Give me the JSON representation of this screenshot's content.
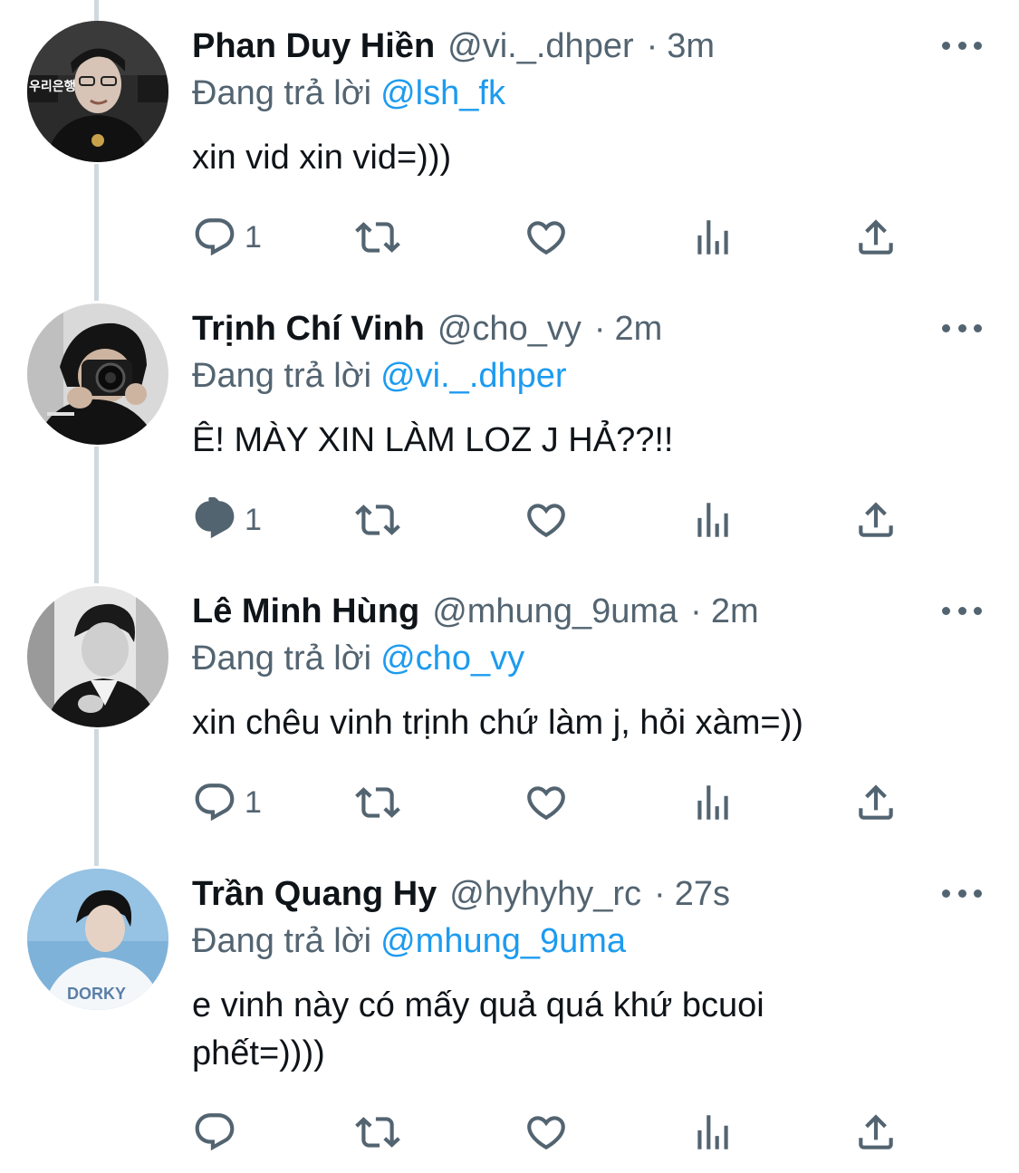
{
  "tweets": [
    {
      "name": "Phan Duy Hiền",
      "handle": "@vi._.dhper",
      "separator": "·",
      "time": "3m",
      "reply_prefix": "Đang trả lời",
      "reply_to": "@lsh_fk",
      "text": "xin vid xin vid=)))",
      "reply_count": "1",
      "avatar_text": "우리은행"
    },
    {
      "name": "Trịnh Chí Vinh",
      "handle": "@cho_vy",
      "separator": "·",
      "time": "2m",
      "reply_prefix": "Đang trả lời",
      "reply_to": "@vi._.dhper",
      "text": "Ê! MÀY XIN LÀM LOZ J HẢ??!!",
      "reply_count": "1"
    },
    {
      "name": "Lê Minh Hùng",
      "handle": "@mhung_9uma",
      "separator": "·",
      "time": "2m",
      "reply_prefix": "Đang trả lời",
      "reply_to": "@cho_vy",
      "text": "xin chêu vinh trịnh chứ làm j, hỏi xàm=))",
      "reply_count": "1"
    },
    {
      "name": "Trần Quang Hy",
      "handle": "@hyhyhy_rc",
      "separator": "·",
      "time": "27s",
      "reply_prefix": "Đang trả lời",
      "reply_to": "@mhung_9uma",
      "text": "e vinh này có mấy quả quá khứ bcuoi phết=))))",
      "reply_count": "",
      "avatar_text": "DORKY"
    }
  ],
  "colors": {
    "text": "#0f1419",
    "secondary": "#536471",
    "link": "#1d9bf0",
    "thread_line": "#cfd9de"
  },
  "icons": [
    "reply-icon",
    "retweet-icon",
    "like-icon",
    "analytics-icon",
    "share-icon",
    "more-icon"
  ]
}
